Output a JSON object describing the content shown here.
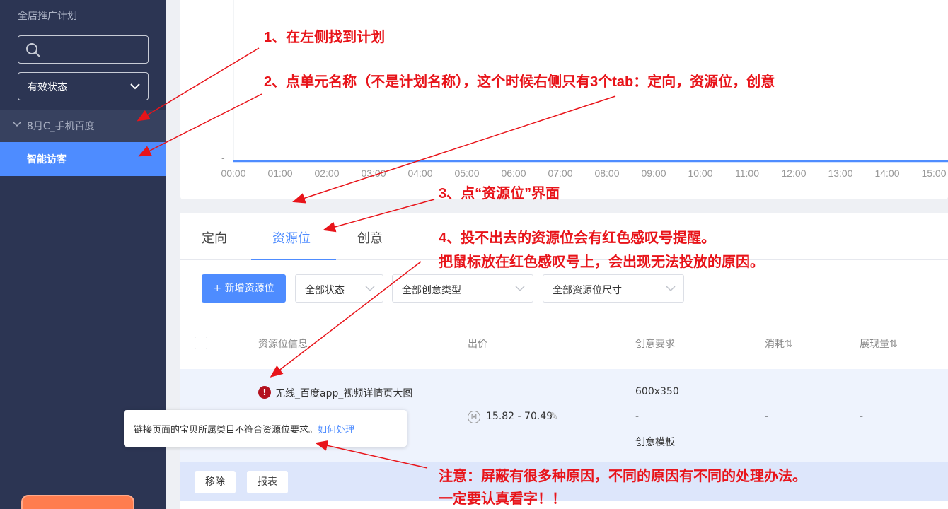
{
  "sidebar": {
    "title": "全店推广计划",
    "status_select": "有效状态",
    "plan_name": "8月C_手机百度",
    "unit_name": "智能访客"
  },
  "chart": {
    "y_tick": "-",
    "x_ticks": [
      "00:00",
      "01:00",
      "02:00",
      "03:00",
      "04:00",
      "05:00",
      "06:00",
      "07:00",
      "08:00",
      "09:00",
      "10:00",
      "11:00",
      "12:00",
      "13:00",
      "14:00",
      "15:00"
    ]
  },
  "tabs": [
    {
      "label": "定向"
    },
    {
      "label": "资源位"
    },
    {
      "label": "创意"
    }
  ],
  "toolbar": {
    "add_label": "+ 新增资源位",
    "filters": [
      "全部状态",
      "全部创意类型",
      "全部资源位尺寸"
    ]
  },
  "table": {
    "headers": {
      "info": "资源位信息",
      "bid": "出价",
      "req": "创意要求",
      "cost": "消耗⇅",
      "impressions": "展现量⇅"
    },
    "row": {
      "name": "无线_百度app_视频详情页大图",
      "bid_icon": "M",
      "bid": "15.82 - 70.49",
      "size": "600x350",
      "dash": "-",
      "template": "创意模板",
      "cost": "-",
      "impressions": "-"
    }
  },
  "actions": {
    "remove": "移除",
    "report": "报表"
  },
  "tooltip": {
    "text": "链接页面的宝贝所属类目不符合资源位要求。",
    "link": "如何处理"
  },
  "annotations": {
    "a1": "1、在左侧找到计划",
    "a2": "2、点单元名称（不是计划名称），这个时候右侧只有3个tab：定向，资源位，创意",
    "a3": "3、点“资源位”界面",
    "a4_line1": "4、投不出去的资源位会有红色感叹号提醒。",
    "a4_line2": "把鼠标放在红色感叹号上，会出现无法投放的原因。",
    "note_line1": "注意：屏蔽有很多种原因，不同的原因有不同的处理办法。",
    "note_line2": "一定要认真看字！！"
  },
  "colors": {
    "sidebar": "#2c3553",
    "accent": "#4e8cff",
    "annotation": "#e8141a",
    "warning": "#b3111e"
  }
}
